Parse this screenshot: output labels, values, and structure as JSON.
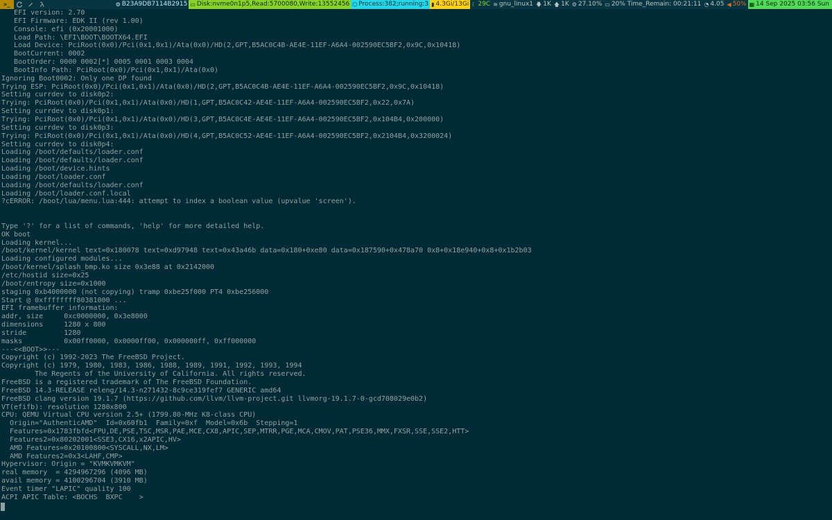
{
  "topbar": {
    "terminal_label": ">_",
    "left_icons": [
      "refresh-icon",
      "edit-icon",
      "lambda-icon"
    ],
    "host": "B23A9DB7114B2915",
    "disk": "Disk:nvme0n1p5,Read:5700080,Write:13552456",
    "process": "Process:382;running:3",
    "memory": "4.3Gi/13Gi",
    "temperature": "29C",
    "network": "gnu_linux1",
    "download": "1K",
    "upload": "1K",
    "cpu": "27.10%",
    "battery": "20% Time_Remain: 00:21:11",
    "load": "4.05",
    "volume": "50%",
    "datetime": "14 Sep 2025 03:56 Sun",
    "colors": {
      "bar_background": "#073642",
      "terminal_button": "#b58900",
      "disk": "#8ad12a",
      "process": "#23d7e8",
      "memory": "#ffd21a",
      "volume": "#e06c2c",
      "date": "#52d85a"
    }
  },
  "console": {
    "background": "#002b36",
    "foreground": "#93a1a1",
    "lines": [
      "   EFI version: 2.70",
      "   EFI Firmware: EDK II (rev 1.00)",
      "   Console: efi (0x20001000)",
      "   Load Path: \\EFI\\BOOT\\BOOTX64.EFI",
      "   Load Device: PciRoot(0x0)/Pci(0x1,0x1)/Ata(0x0)/HD(2,GPT,B5AC0C4B-AE4E-11EF-A6A4-002590EC5BF2,0x9C,0x10418)",
      "   BootCurrent: 0002",
      "   BootOrder: 0000 0002[*] 0005 0001 0003 0004",
      "   BootInfo Path: PciRoot(0x0)/Pci(0x1,0x1)/Ata(0x0)",
      "Ignoring Boot0002: Only one DP found",
      "Trying ESP: PciRoot(0x0)/Pci(0x1,0x1)/Ata(0x0)/HD(2,GPT,B5AC0C4B-AE4E-11EF-A6A4-002590EC5BF2,0x9C,0x10418)",
      "Setting currdev to disk0p2:",
      "Trying: PciRoot(0x0)/Pci(0x1,0x1)/Ata(0x0)/HD(1,GPT,B5AC0C42-AE4E-11EF-A6A4-002590EC5BF2,0x22,0x7A)",
      "Setting currdev to disk0p1:",
      "Trying: PciRoot(0x0)/Pci(0x1,0x1)/Ata(0x0)/HD(3,GPT,B5AC0C4E-AE4E-11EF-A6A4-002590EC5BF2,0x104B4,0x200000)",
      "Setting currdev to disk0p3:",
      "Trying: PciRoot(0x0)/Pci(0x1,0x1)/Ata(0x0)/HD(4,GPT,B5AC0C52-AE4E-11EF-A6A4-002590EC5BF2,0x2104B4,0x3200024)",
      "Setting currdev to disk0p4:",
      "Loading /boot/defaults/loader.conf",
      "Loading /boot/defaults/loader.conf",
      "Loading /boot/device.hints",
      "Loading /boot/loader.conf",
      "Loading /boot/defaults/loader.conf",
      "Loading /boot/loader.conf.local",
      "?cERROR: /boot/lua/menu.lua:444: attempt to index a boolean value (upvalue 'screen').",
      "",
      "",
      "Type '?' for a list of commands, 'help' for more detailed help.",
      "OK boot",
      "Loading kernel...",
      "/boot/kernel/kernel text=0x180078 text=0xd97948 text=0x43a46b data=0x180+0xe80 data=0x187590+0x478a70 0x8+0x18e940+0x8+0x1b2b03",
      "Loading configured modules...",
      "/boot/kernel/splash_bmp.ko size 0x3e88 at 0x2142000",
      "/etc/hostid size=0x25",
      "/boot/entropy size=0x1000",
      "staging 0xb4000000 (not copying) tramp 0xbe25f000 PT4 0xbe256000",
      "Start @ 0xffffffff80381000 ...",
      "EFI framebuffer information:",
      "addr, size     0xc0000000, 0x3e8000",
      "dimensions     1280 x 800",
      "stride         1280",
      "masks          0x00ff0000, 0x0000ff00, 0x000000ff, 0xff000000",
      "---<<BOOT>>---",
      "Copyright (c) 1992-2023 The FreeBSD Project.",
      "Copyright (c) 1979, 1980, 1983, 1986, 1988, 1989, 1991, 1992, 1993, 1994",
      "        The Regents of the University of California. All rights reserved.",
      "FreeBSD is a registered trademark of The FreeBSD Foundation.",
      "FreeBSD 14.3-RELEASE releng/14.3-n271432-8c9ce319fef7 GENERIC amd64",
      "FreeBSD clang version 19.1.7 (https://github.com/llvm/llvm-project.git llvmorg-19.1.7-0-gcd708029e0b2)",
      "VT(efifb): resolution 1280x800",
      "CPU: QEMU Virtual CPU version 2.5+ (1799.80-MHz K8-class CPU)",
      "  Origin=\"AuthenticAMD\"  Id=0x60fb1  Family=0xf  Model=0x6b  Stepping=1",
      "  Features=0x1783fbfd<FPU,DE,PSE,TSC,MSR,PAE,MCE,CX8,APIC,SEP,MTRR,PGE,MCA,CMOV,PAT,PSE36,MMX,FXSR,SSE,SSE2,HTT>",
      "  Features2=0x80202001<SSE3,CX16,x2APIC,HV>",
      "  AMD Features=0x20100800<SYSCALL,NX,LM>",
      "  AMD Features2=0x3<LAHF,CMP>",
      "Hypervisor: Origin = \"KVMKVMKVM\"",
      "real memory  = 4294967296 (4096 MB)",
      "avail memory = 4100296704 (3910 MB)",
      "Event timer \"LAPIC\" quality 100",
      "ACPI APIC Table: <BOCHS  BXPC    >"
    ]
  }
}
